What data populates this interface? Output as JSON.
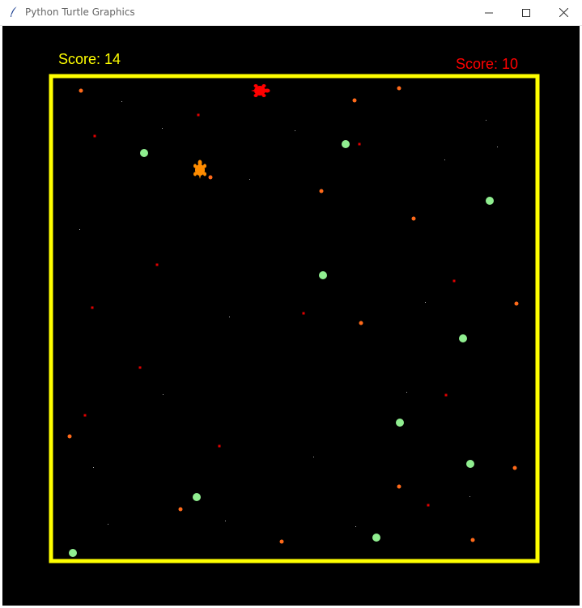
{
  "window": {
    "title": "Python Turtle Graphics",
    "controls": [
      "minimize-icon",
      "maximize-icon",
      "close-icon"
    ]
  },
  "game": {
    "background": "#000000",
    "border_color": "#ffff00",
    "player1": {
      "score_label": "Score: 14",
      "score": 14,
      "color": "#ffff00",
      "turtle_color": "#ff8c00"
    },
    "player2": {
      "score_label": "Score: 10",
      "score": 10,
      "color": "#ff0000",
      "turtle_color": "#ff0000"
    },
    "food_colors": {
      "green": "#90ee90",
      "orange": "#ff6a1a",
      "red": "#e00000"
    }
  }
}
